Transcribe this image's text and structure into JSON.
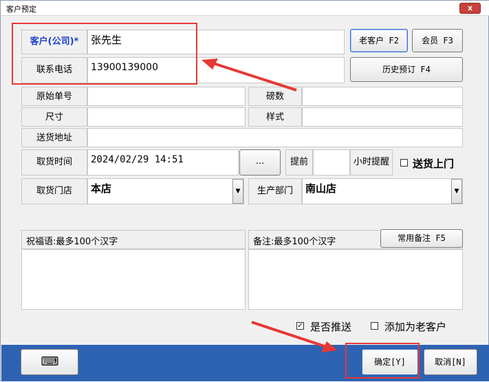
{
  "window": {
    "title": "客户预定",
    "close_label": "x"
  },
  "customer": {
    "label": "客户(公司)*",
    "value": "张先生"
  },
  "phone": {
    "label": "联系电话",
    "value": "13900139000"
  },
  "buttons": {
    "old_customer": "老客户 F2",
    "member": "会员 F3",
    "history": "历史预订 F4",
    "common_note": "常用备注 F5",
    "confirm": "确定[Y]",
    "cancel": "取消[N]",
    "ellipsis": "..."
  },
  "fields": {
    "original_no": {
      "label": "原始单号",
      "value": ""
    },
    "weight": {
      "label": "磅数",
      "value": ""
    },
    "size": {
      "label": "尺寸",
      "value": ""
    },
    "style": {
      "label": "样式",
      "value": ""
    },
    "address": {
      "label": "送货地址",
      "value": ""
    },
    "pickup_time": {
      "label": "取货时间",
      "value": "2024/02/29 14:51"
    },
    "advance": {
      "label": "提前",
      "value": ""
    },
    "hours_reminder": {
      "label": "小时提醒"
    },
    "delivery": {
      "label": "送货上门",
      "checked": false
    },
    "pickup_store": {
      "label": "取货门店",
      "value": "本店"
    },
    "production_dept": {
      "label": "生产部门",
      "value": "南山店"
    }
  },
  "blessing": {
    "label": "祝福语:最多100个汉字",
    "value": ""
  },
  "note": {
    "label": "备注:最多100个汉字",
    "value": ""
  },
  "options": {
    "push": {
      "label": "是否推送",
      "checked": true
    },
    "add_old": {
      "label": "添加为老客户",
      "checked": false
    }
  },
  "colors": {
    "accent": "#2e63b3",
    "highlight": "#e53935",
    "customer_label": "#1a3fd1"
  }
}
